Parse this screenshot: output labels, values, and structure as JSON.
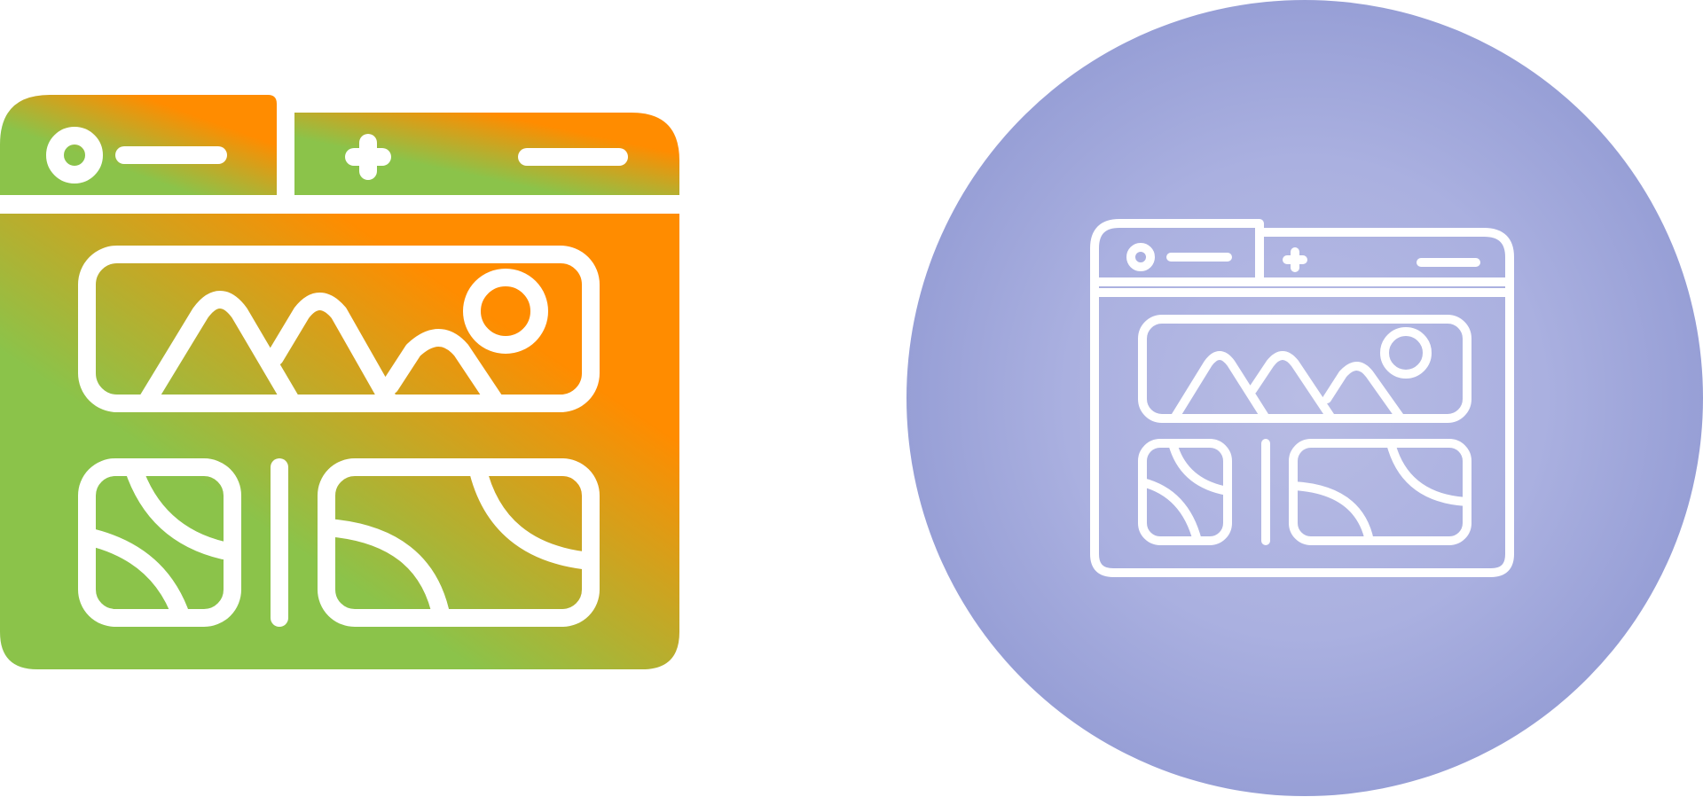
{
  "icons": [
    {
      "name": "browser-gallery-glyph-icon",
      "style": "glyph",
      "colors": {
        "gradient_start": "#8BC34A",
        "gradient_end": "#FF8C00",
        "stroke": "#FFFFFF"
      }
    },
    {
      "name": "browser-gallery-outline-icon",
      "style": "outline-in-circle",
      "colors": {
        "circle_center": "#B8BCE4",
        "circle_edge": "#979FD6",
        "stroke": "#FFFFFF"
      }
    }
  ]
}
